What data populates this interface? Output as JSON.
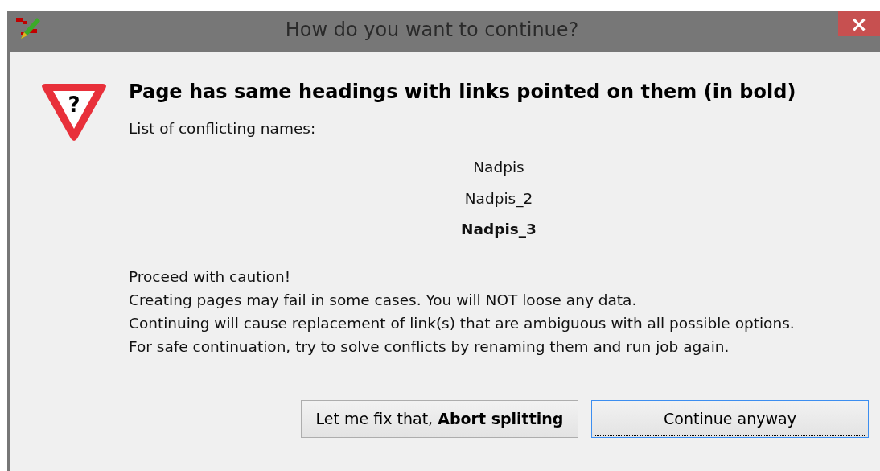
{
  "window": {
    "title": "How do you want to continue?",
    "close": "×"
  },
  "icon_symbol": "?",
  "heading": "Page has same headings with links pointed on them (in bold)",
  "list_label": "List of conflicting names:",
  "names": [
    {
      "text": "Nadpis",
      "bold": false
    },
    {
      "text": "Nadpis_2",
      "bold": false
    },
    {
      "text": "Nadpis_3",
      "bold": true
    }
  ],
  "message_lines": [
    "Proceed with caution!",
    "Creating pages may fail in some cases. You will NOT loose any data.",
    "Continuing will cause replacement of link(s) that are ambiguous with all possible options.",
    "For safe continuation, try to solve conflicts by renaming them and run job again."
  ],
  "buttons": [
    {
      "label": "Let me fix that, **Abort splitting**",
      "focused": false
    },
    {
      "label": "Continue anyway",
      "focused": true
    }
  ]
}
